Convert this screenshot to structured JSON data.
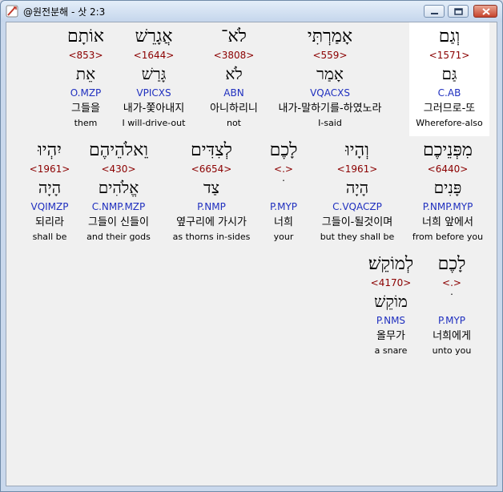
{
  "window": {
    "title": "@원전분해 - 삿 2:3"
  },
  "words": [
    {
      "hebrew": "וְגַם",
      "strong": "<1571>",
      "lemma": "גַּם",
      "parse": "C.AB",
      "korean": "그러므로-또",
      "english": "Wherefore-also",
      "highlighted": true
    },
    {
      "hebrew": "אָמַרְתִּי",
      "strong": "<559>",
      "lemma": "אָמַר",
      "parse": "VQACXS",
      "korean": "내가-말하기를-하였노라",
      "english": "I-said",
      "highlighted": false
    },
    {
      "hebrew": "לֹא־",
      "strong": "<3808>",
      "lemma": "לֹא",
      "parse": "ABN",
      "korean": "아니하리니",
      "english": "not",
      "highlighted": false
    },
    {
      "hebrew": "אֲגָרֵשׁ",
      "strong": "<1644>",
      "lemma": "גָּרַשׁ",
      "parse": "VPICXS",
      "korean": "내가-쫓아내지",
      "english": "I will-drive-out",
      "highlighted": false
    },
    {
      "hebrew": "אוֹתָם",
      "strong": "<853>",
      "lemma": "אֵת",
      "parse": "O.MZP",
      "korean": "그들을",
      "english": "them",
      "highlighted": false
    },
    {
      "hebrew": "מִפְּנֵיכֶם",
      "strong": "<6440>",
      "lemma": "פָּנִים",
      "parse": "P.NMP.MYP",
      "korean": "너희 앞에서",
      "english": "from before you",
      "highlighted": false
    },
    {
      "hebrew": "וְהָיוּ",
      "strong": "<1961>",
      "lemma": "הָיָה",
      "parse": "C.VQACZP",
      "korean": "그들이-될것이며",
      "english": "but they shall be",
      "highlighted": false
    },
    {
      "hebrew": "לָכֶם",
      "strong": "<.>",
      "lemma": "ׄ",
      "parse": "P.MYP",
      "korean": "너희",
      "english": "your",
      "highlighted": false
    },
    {
      "hebrew": "לְצִדִּים",
      "strong": "<6654>",
      "lemma": "צַד",
      "parse": "P.NMP",
      "korean": "옆구리에 가시가",
      "english": "as thorns in-sides",
      "highlighted": false
    },
    {
      "hebrew": "וֵאלֹהֵיהֶם",
      "strong": "<430>",
      "lemma": "אֱלֹהִים",
      "parse": "C.NMP.MZP",
      "korean": "그들이 신들이",
      "english": "and their gods",
      "highlighted": false
    },
    {
      "hebrew": "יִהְיוּ",
      "strong": "<1961>",
      "lemma": "הָיָה",
      "parse": "VQIMZP",
      "korean": "되리라",
      "english": "shall be",
      "highlighted": false
    },
    {
      "hebrew": "לָכֶם",
      "strong": "<.>",
      "lemma": "ׄ",
      "parse": "P.MYP",
      "korean": "너희에게",
      "english": "unto you",
      "highlighted": false
    },
    {
      "hebrew": "לְמוֹקֵשׁ׃",
      "strong": "<4170>",
      "lemma": "מוֹקֵשׁ",
      "parse": "P.NMS",
      "korean": "올무가",
      "english": "a snare",
      "highlighted": false
    }
  ],
  "colors": {
    "strong": "#8b0000",
    "parse": "#1f2fbf",
    "highlight": "#ffffff"
  }
}
